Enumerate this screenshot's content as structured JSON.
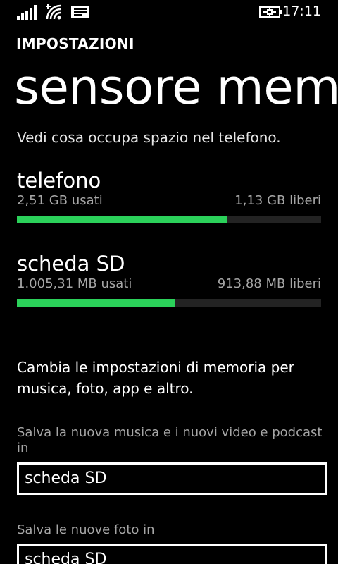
{
  "status_bar": {
    "time": "17:11",
    "icons": [
      "signal-icon",
      "wifi-icon",
      "message-icon",
      "battery-charging-icon"
    ]
  },
  "header": {
    "app_title": "IMPOSTAZIONI",
    "page_title": "sensore memoria"
  },
  "intro": "Vedi cosa occupa spazio nel telefono.",
  "storage": [
    {
      "name": "telefono",
      "used": "2,51 GB usati",
      "free": "1,13 GB liberi",
      "used_fraction": 0.69
    },
    {
      "name": "scheda SD",
      "used": "1.005,31 MB usati",
      "free": "913,88 MB liberi",
      "used_fraction": 0.52
    }
  ],
  "settings": {
    "description": "Cambia le impostazioni di memoria per musica, foto, app e altro.",
    "music_label": "Salva la nuova musica e i nuovi video e podcast in",
    "music_value": "scheda SD",
    "photos_label": "Salva le nuove foto in",
    "photos_value": "scheda SD"
  },
  "colors": {
    "accent": "#2bd15a",
    "background": "#000000",
    "track": "#232323",
    "secondary_text": "#a6a6a6"
  }
}
